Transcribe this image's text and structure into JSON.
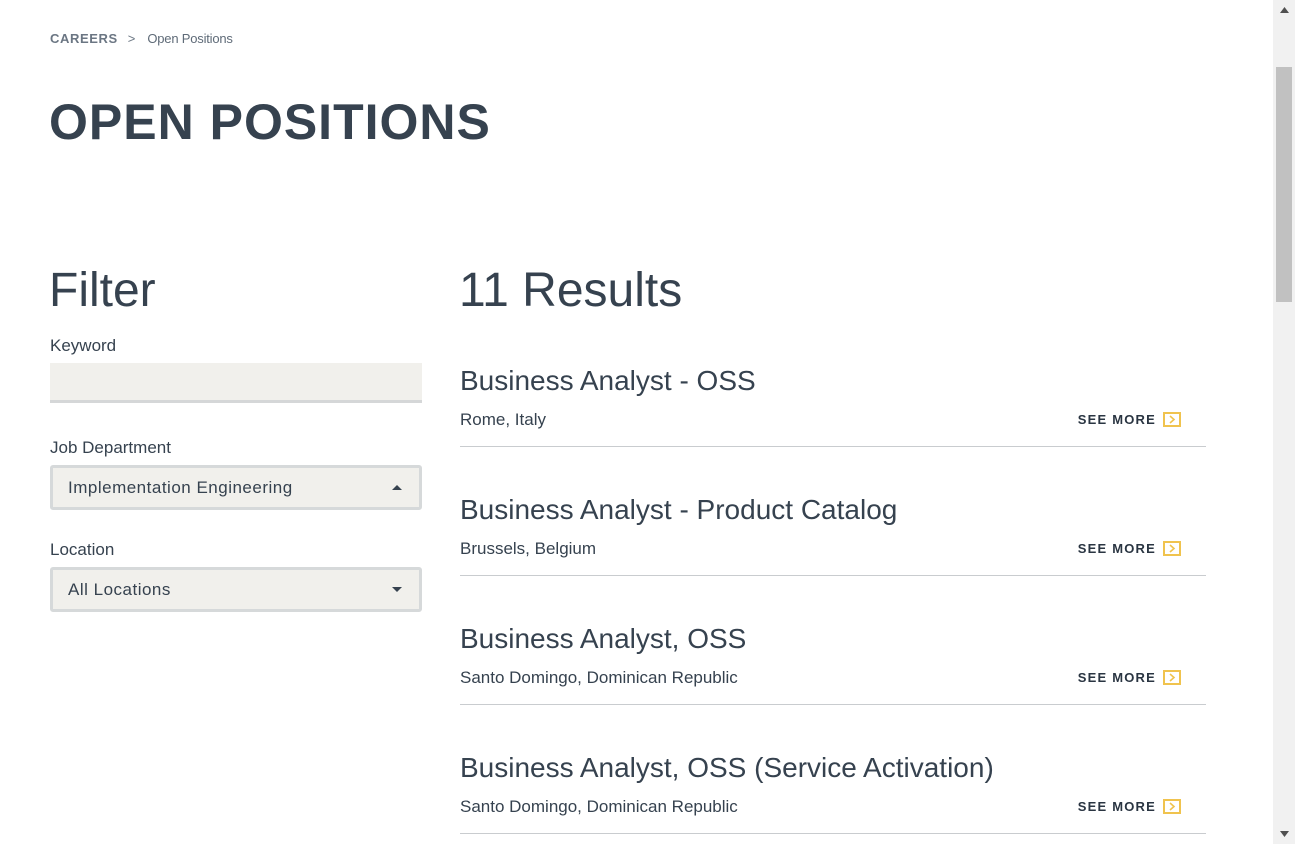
{
  "breadcrumb": {
    "root": "CAREERS",
    "separator": ">",
    "current": "Open Positions"
  },
  "page_title": "OPEN POSITIONS",
  "filter": {
    "heading": "Filter",
    "keyword_label": "Keyword",
    "keyword_value": "",
    "department_label": "Job Department",
    "department_value": "Implementation Engineering",
    "department_open": true,
    "location_label": "Location",
    "location_value": "All Locations"
  },
  "results": {
    "heading": "11 Results",
    "see_more_label": "SEE MORE",
    "jobs": [
      {
        "title": "Business Analyst - OSS",
        "location": "Rome, Italy"
      },
      {
        "title": "Business Analyst - Product Catalog",
        "location": "Brussels, Belgium"
      },
      {
        "title": "Business Analyst, OSS",
        "location": "Santo Domingo, Dominican Republic"
      },
      {
        "title": "Business Analyst, OSS (Service Activation)",
        "location": "Santo Domingo, Dominican Republic"
      }
    ]
  },
  "icons": {
    "see_more": "chevron-right-box-icon",
    "select_open": "caret-up-icon",
    "select_closed": "caret-down-icon"
  },
  "colors": {
    "text": "#36424f",
    "accent": "#f0c34e",
    "field_background": "#f1f0ec"
  }
}
